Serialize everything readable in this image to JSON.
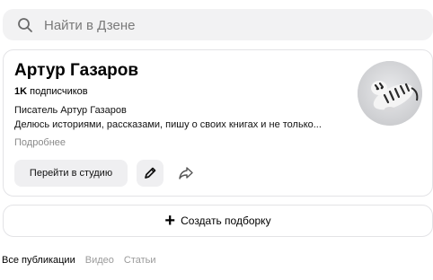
{
  "search": {
    "placeholder": "Найти в Дзене",
    "icon": "search-icon"
  },
  "channel": {
    "name": "Артур Газаров",
    "subscribers_count": "1K",
    "subscribers_label": "подписчиков",
    "description_line1": "Писатель Артур Газаров",
    "description_line2": "Делюсь историями, рассказами, пишу о своих книгах и не только...",
    "more_label": "Подробнее",
    "avatar_icon": "tiger-avatar"
  },
  "actions": {
    "studio_label": "Перейти в студию",
    "edit_icon": "pencil-icon",
    "share_icon": "share-arrow-icon"
  },
  "create_collection": {
    "label": "Создать подборку",
    "icon": "plus-icon"
  },
  "tabs": [
    {
      "label": "Все публикации",
      "active": true
    },
    {
      "label": "Видео",
      "active": false
    },
    {
      "label": "Статьи",
      "active": false
    }
  ],
  "colors": {
    "search_bg": "#f2f2f3",
    "button_bg": "#efeff1",
    "card_border": "#e3e3e6",
    "muted_text": "#8a8a8a"
  }
}
